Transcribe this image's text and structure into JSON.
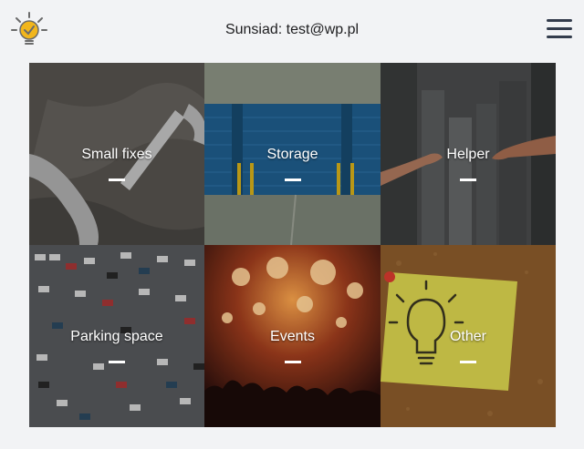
{
  "header": {
    "title": "Sunsiad: test@wp.pl",
    "logo_icon": "lightbulb-icon",
    "menu_icon": "hamburger-menu-icon"
  },
  "colors": {
    "background": "#f2f3f5",
    "menu": "#333c4c",
    "logo_bulb": "#f2b61c"
  },
  "categories": [
    {
      "label": "Small fixes",
      "image": "wrench-on-concrete"
    },
    {
      "label": "Storage",
      "image": "blue-garage-doors"
    },
    {
      "label": "Helper",
      "image": "reaching-hands"
    },
    {
      "label": "Parking space",
      "image": "aerial-parking-lot"
    },
    {
      "label": "Events",
      "image": "concert-crowd-lights"
    },
    {
      "label": "Other",
      "image": "lightbulb-sticky-note-corkboard"
    }
  ]
}
